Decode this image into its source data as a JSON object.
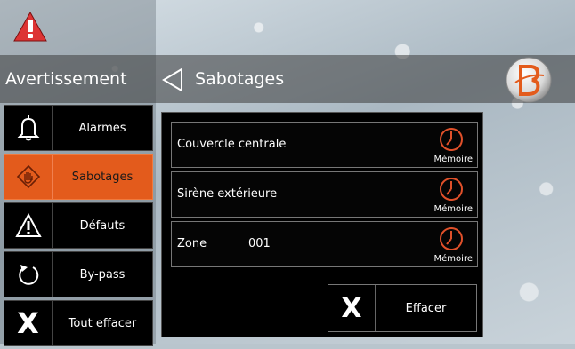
{
  "header": {
    "section_title": "Avertissement",
    "page_title": "Sabotages",
    "alert_icon": "warning-triangle-icon",
    "logo": "brand-logo"
  },
  "menu": {
    "items": [
      {
        "label": "Alarmes",
        "icon": "bell-icon"
      },
      {
        "label": "Sabotages",
        "icon": "hand-tamper-icon",
        "active": true
      },
      {
        "label": "Défauts",
        "icon": "warning-icon"
      },
      {
        "label": "By-pass",
        "icon": "rotate-arrow-icon"
      },
      {
        "label": "Tout effacer",
        "icon": "x-icon",
        "glyph": "X"
      }
    ]
  },
  "events": {
    "rows": [
      {
        "name": "Couvercle centrale",
        "number": "",
        "action": "Mémoire"
      },
      {
        "name": "Sirène extérieure",
        "number": "",
        "action": "Mémoire"
      },
      {
        "name": "Zone",
        "number": "001",
        "action": "Mémoire"
      }
    ],
    "clear_glyph": "X",
    "clear_label": "Effacer"
  },
  "colors": {
    "accent": "#e35b1c",
    "clock_icon": "#e0502a",
    "panel_bg": "#000000"
  }
}
